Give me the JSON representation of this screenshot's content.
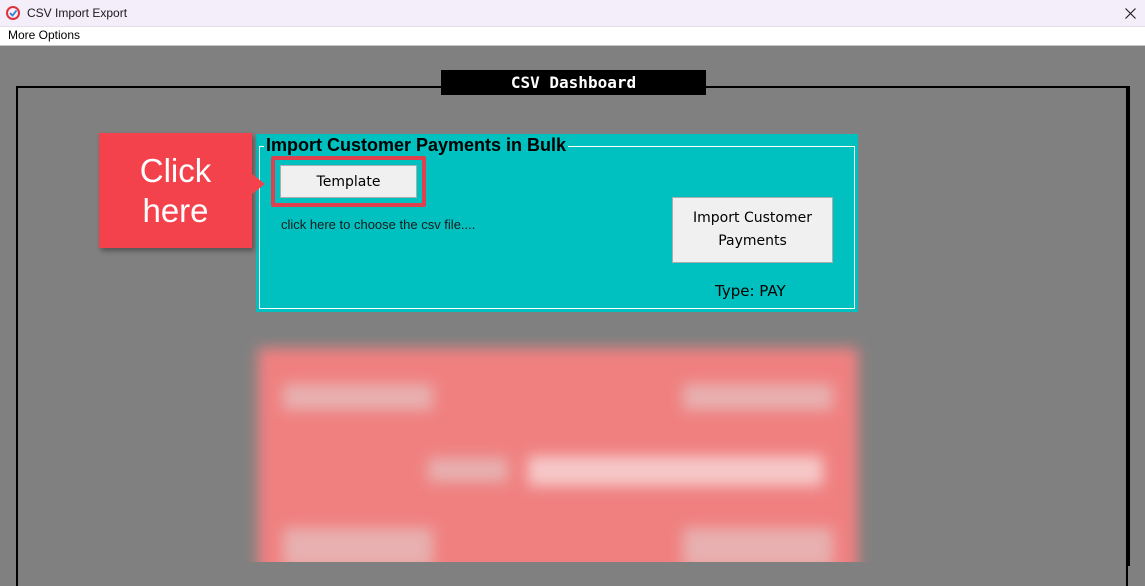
{
  "window": {
    "title": "CSV Import Export",
    "icon": "app-logo-icon",
    "close_icon": "close-icon"
  },
  "menu": {
    "more_options": "More Options"
  },
  "dashboard": {
    "title": "CSV Dashboard"
  },
  "import_panel": {
    "title": "Import Customer Payments in Bulk",
    "template_button": "Template",
    "choose_file_link": "click here to choose the csv file....",
    "import_button_line1": "Import Customer",
    "import_button_line2": "Payments",
    "type_label": "Type: PAY",
    "background_color": "#00c0c0"
  },
  "callout": {
    "line1": "Click",
    "line2": "here",
    "color": "#f4424c"
  },
  "colors": {
    "workspace": "#808080",
    "highlight": "#e0404d"
  }
}
